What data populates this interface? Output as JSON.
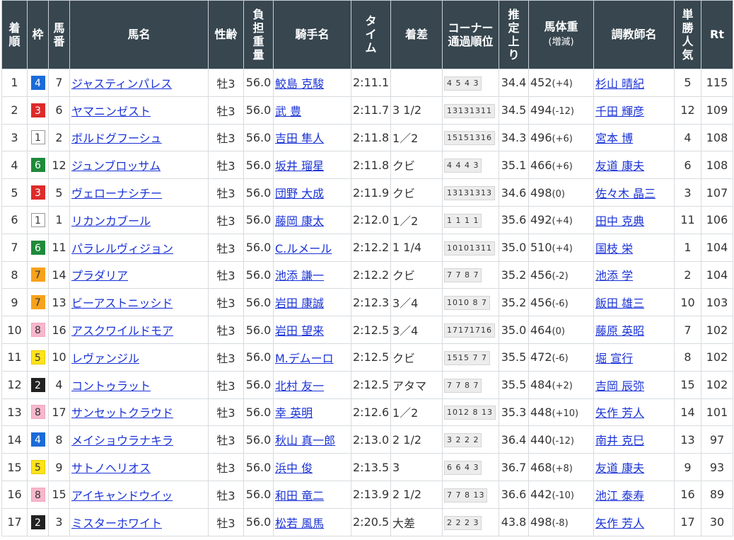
{
  "headers": {
    "rank": "着順",
    "frame": "枠",
    "number": "馬番",
    "horse": "馬名",
    "sex_age": "性齢",
    "weight_carried": "負担重量",
    "jockey": "騎手名",
    "time": "タイム",
    "margin": "着差",
    "corner_line1": "コーナー",
    "corner_line2": "通過順位",
    "last3f": "推定上り",
    "body_weight": "馬体重",
    "body_weight_sub": "(増減)",
    "trainer": "調教師名",
    "popularity": "単勝人気",
    "rating": "Rt"
  },
  "frame_colors": {
    "1": "#ffffff",
    "2": "#222222",
    "3": "#dd2b2b",
    "4": "#1b6bd8",
    "5": "#ffe31a",
    "6": "#1e8a3a",
    "7": "#f7a21c",
    "8": "#f7b8cc"
  },
  "rows": [
    {
      "rank": "1",
      "frame": "4",
      "num": "7",
      "horse": "ジャスティンパレス",
      "sex": "牡3",
      "wt": "56.0",
      "jockey": "鮫島 克駿",
      "time": "2:11.1",
      "margin": "",
      "corner": "4 5 4 3",
      "last3f": "34.4",
      "bw": "452",
      "bwc": "(+4)",
      "trainer": "杉山 晴紀",
      "pop": "5",
      "rt": "115"
    },
    {
      "rank": "2",
      "frame": "3",
      "num": "6",
      "horse": "ヤマニンゼスト",
      "sex": "牡3",
      "wt": "56.0",
      "jockey": "武 豊",
      "time": "2:11.7",
      "margin": "3 1/2",
      "corner": "13131311",
      "last3f": "34.5",
      "bw": "494",
      "bwc": "(-12)",
      "trainer": "千田 輝彦",
      "pop": "12",
      "rt": "109"
    },
    {
      "rank": "3",
      "frame": "1",
      "num": "2",
      "horse": "ボルドグフーシュ",
      "sex": "牡3",
      "wt": "56.0",
      "jockey": "吉田 隼人",
      "time": "2:11.8",
      "margin": "1／2",
      "corner": "15151316",
      "last3f": "34.3",
      "bw": "496",
      "bwc": "(+6)",
      "trainer": "宮本 博",
      "pop": "4",
      "rt": "108"
    },
    {
      "rank": "4",
      "frame": "6",
      "num": "12",
      "horse": "ジュンブロッサム",
      "sex": "牡3",
      "wt": "56.0",
      "jockey": "坂井 瑠星",
      "time": "2:11.8",
      "margin": "クビ",
      "corner": "4 4 4 3",
      "last3f": "35.1",
      "bw": "466",
      "bwc": "(+6)",
      "trainer": "友道 康夫",
      "pop": "6",
      "rt": "108"
    },
    {
      "rank": "5",
      "frame": "3",
      "num": "5",
      "horse": "ヴェローナシチー",
      "sex": "牡3",
      "wt": "56.0",
      "jockey": "団野 大成",
      "time": "2:11.9",
      "margin": "クビ",
      "corner": "13131313",
      "last3f": "34.6",
      "bw": "498",
      "bwc": "(0)",
      "trainer": "佐々木 晶三",
      "pop": "3",
      "rt": "107"
    },
    {
      "rank": "6",
      "frame": "1",
      "num": "1",
      "horse": "リカンカブール",
      "sex": "牡3",
      "wt": "56.0",
      "jockey": "藤岡 康太",
      "time": "2:12.0",
      "margin": "1／2",
      "corner": "1 1 1 1",
      "last3f": "35.6",
      "bw": "492",
      "bwc": "(+4)",
      "trainer": "田中 克典",
      "pop": "11",
      "rt": "106"
    },
    {
      "rank": "7",
      "frame": "6",
      "num": "11",
      "horse": "パラレルヴィジョン",
      "sex": "牡3",
      "wt": "56.0",
      "jockey": "C.ルメール",
      "time": "2:12.2",
      "margin": "1 1/4",
      "corner": "10101311",
      "last3f": "35.0",
      "bw": "510",
      "bwc": "(+4)",
      "trainer": "国枝 栄",
      "pop": "1",
      "rt": "104"
    },
    {
      "rank": "8",
      "frame": "7",
      "num": "14",
      "horse": "プラダリア",
      "sex": "牡3",
      "wt": "56.0",
      "jockey": "池添 謙一",
      "time": "2:12.2",
      "margin": "クビ",
      "corner": "7 7 8 7",
      "last3f": "35.2",
      "bw": "456",
      "bwc": "(-2)",
      "trainer": "池添 学",
      "pop": "2",
      "rt": "104"
    },
    {
      "rank": "9",
      "frame": "7",
      "num": "13",
      "horse": "ビーアストニッシド",
      "sex": "牡3",
      "wt": "56.0",
      "jockey": "岩田 康誠",
      "time": "2:12.3",
      "margin": "3／4",
      "corner": "1010 8 7",
      "last3f": "35.2",
      "bw": "456",
      "bwc": "(-6)",
      "trainer": "飯田 雄三",
      "pop": "10",
      "rt": "103"
    },
    {
      "rank": "10",
      "frame": "8",
      "num": "16",
      "horse": "アスクワイルドモア",
      "sex": "牡3",
      "wt": "56.0",
      "jockey": "岩田 望来",
      "time": "2:12.5",
      "margin": "3／4",
      "corner": "17171716",
      "last3f": "35.0",
      "bw": "464",
      "bwc": "(0)",
      "trainer": "藤原 英昭",
      "pop": "7",
      "rt": "102"
    },
    {
      "rank": "11",
      "frame": "5",
      "num": "10",
      "horse": "レヴァンジル",
      "sex": "牡3",
      "wt": "56.0",
      "jockey": "M.デムーロ",
      "time": "2:12.5",
      "margin": "クビ",
      "corner": "1515 7 7",
      "last3f": "35.5",
      "bw": "472",
      "bwc": "(-6)",
      "trainer": "堀 宣行",
      "pop": "8",
      "rt": "102"
    },
    {
      "rank": "12",
      "frame": "2",
      "num": "4",
      "horse": "コントゥラット",
      "sex": "牡3",
      "wt": "56.0",
      "jockey": "北村 友一",
      "time": "2:12.5",
      "margin": "アタマ",
      "corner": "7 7 8 7",
      "last3f": "35.5",
      "bw": "484",
      "bwc": "(+2)",
      "trainer": "吉岡 辰弥",
      "pop": "15",
      "rt": "102"
    },
    {
      "rank": "13",
      "frame": "8",
      "num": "17",
      "horse": "サンセットクラウド",
      "sex": "牡3",
      "wt": "56.0",
      "jockey": "幸 英明",
      "time": "2:12.6",
      "margin": "1／2",
      "corner": "1012 8 13",
      "last3f": "35.3",
      "bw": "448",
      "bwc": "(+10)",
      "trainer": "矢作 芳人",
      "pop": "14",
      "rt": "101"
    },
    {
      "rank": "14",
      "frame": "4",
      "num": "8",
      "horse": "メイショウラナキラ",
      "sex": "牡3",
      "wt": "56.0",
      "jockey": "秋山 真一郎",
      "time": "2:13.0",
      "margin": "2 1/2",
      "corner": "3 2 2 2",
      "last3f": "36.4",
      "bw": "440",
      "bwc": "(-12)",
      "trainer": "南井 克巳",
      "pop": "13",
      "rt": "97"
    },
    {
      "rank": "15",
      "frame": "5",
      "num": "9",
      "horse": "サトノヘリオス",
      "sex": "牡3",
      "wt": "56.0",
      "jockey": "浜中 俊",
      "time": "2:13.5",
      "margin": "3",
      "corner": "6 6 4 3",
      "last3f": "36.7",
      "bw": "468",
      "bwc": "(+8)",
      "trainer": "友道 康夫",
      "pop": "9",
      "rt": "93"
    },
    {
      "rank": "16",
      "frame": "8",
      "num": "15",
      "horse": "アイキャンドウイッ",
      "sex": "牡3",
      "wt": "56.0",
      "jockey": "和田 竜二",
      "time": "2:13.9",
      "margin": "2 1/2",
      "corner": "7 7 8 13",
      "last3f": "36.6",
      "bw": "442",
      "bwc": "(-10)",
      "trainer": "池江 泰寿",
      "pop": "16",
      "rt": "89"
    },
    {
      "rank": "17",
      "frame": "2",
      "num": "3",
      "horse": "ミスターホワイト",
      "sex": "牡3",
      "wt": "56.0",
      "jockey": "松若 風馬",
      "time": "2:20.5",
      "margin": "大差",
      "corner": "2 2 2 3",
      "last3f": "43.8",
      "bw": "498",
      "bwc": "(-8)",
      "trainer": "矢作 芳人",
      "pop": "17",
      "rt": "30"
    }
  ]
}
